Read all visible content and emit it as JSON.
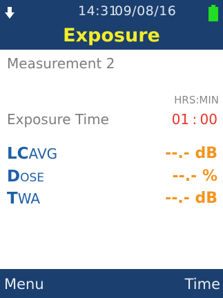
{
  "status": {
    "time": "14:31",
    "date": "09/08/16",
    "download_icon": "download-arrow-icon",
    "battery_icon": "battery-icon",
    "battery_color": "#22dd22"
  },
  "header": {
    "title": "Exposure",
    "title_color": "#f4ec28",
    "background": "#1b3f6e"
  },
  "content": {
    "measurement_label": "Measurement 2",
    "units_label": "HRS:MIN",
    "exposure_time_label": "Exposure Time",
    "exposure_time_value": "01 : 00",
    "metrics": [
      {
        "lead": "LC",
        "rest": "AVG",
        "value": "--.- dB"
      },
      {
        "lead": "D",
        "rest": "OSE",
        "value": "--.- %"
      },
      {
        "lead": "T",
        "rest": "WA",
        "value": "--.- dB"
      }
    ],
    "label_color": "#1e5fa8",
    "value_color": "#f2941e",
    "exposure_value_color": "#e8342c"
  },
  "footer": {
    "left_softkey": "Menu",
    "right_softkey": "Time"
  }
}
